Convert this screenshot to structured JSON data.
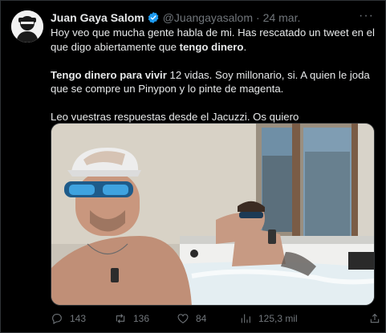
{
  "tweet": {
    "author_name": "Juan Gaya Salom",
    "handle": "@Juangayasalom",
    "separator": "·",
    "date": "24 mar.",
    "more_label": "···",
    "para1_a": "Hoy veo que mucha gente habla de mi. Has rescatado un tweet en el que digo abiertamente que ",
    "para1_bold": "tengo dinero",
    "para1_b": ".",
    "para2_bold": "Tengo dinero para vivir",
    "para2_rest": " 12 vidas. Soy millonario, si. A quien le joda que se compre un Pinypon y lo pinte de magenta.",
    "para3": "Leo vuestras respuestas desde el Jacuzzi. Os quiero"
  },
  "actions": {
    "replies": "143",
    "retweets": "136",
    "likes": "84",
    "views": "125,3 mil"
  },
  "colors": {
    "background": "#000000",
    "text": "#e7e9ea",
    "muted": "#71767b",
    "verified": "#1d9bf0"
  }
}
